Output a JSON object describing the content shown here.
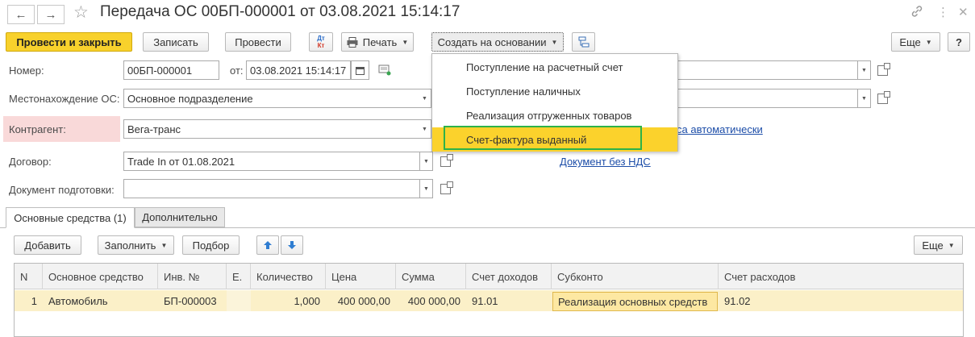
{
  "window": {
    "title": "Передача ОС 00БП-000001 от 03.08.2021 15:14:17"
  },
  "toolbar": {
    "post_close": "Провести и закрыть",
    "save": "Записать",
    "post": "Провести",
    "dtkt_top": "Дт",
    "dtkt_bottom": "Кт",
    "print": "Печать",
    "create_based": "Создать на основании",
    "more": "Еще",
    "help": "?"
  },
  "create_menu": {
    "items": [
      "Поступление на расчетный счет",
      "Поступление наличных",
      "Реализация отгруженных товаров",
      "Счет-фактура выданный"
    ],
    "highlighted_index": 3
  },
  "form": {
    "number_label": "Номер:",
    "number_value": "00БП-000001",
    "date_label": "от:",
    "date_value": "03.08.2021 15:14:17",
    "location_label": "Местонахождение ОС:",
    "location_value": "Основное подразделение",
    "counterparty_label": "Контрагент:",
    "counterparty_value": "Вега-транс",
    "contract_label": "Договор:",
    "contract_value": "Trade In от 01.08.2021",
    "prep_doc_label": "Документ подготовки:",
    "prep_doc_value": "",
    "link_auto": "са автоматически",
    "link_no_vat": "Документ без НДС"
  },
  "tabs": [
    {
      "label": "Основные средства (1)",
      "active": true
    },
    {
      "label": "Дополнительно",
      "active": false
    }
  ],
  "table_toolbar": {
    "add": "Добавить",
    "fill": "Заполнить",
    "select": "Подбор",
    "more": "Еще"
  },
  "table": {
    "columns": [
      "N",
      "Основное средство",
      "Инв. №",
      "Е.",
      "Количество",
      "Цена",
      "Сумма",
      "Счет доходов",
      "Субконто",
      "Счет расходов"
    ],
    "rows": [
      [
        "1",
        "Автомобиль",
        "БП-000003",
        "",
        "1,000",
        "400 000,00",
        "400 000,00",
        "91.01",
        "Реализация основных средств",
        "91.02"
      ]
    ]
  },
  "colors": {
    "primary_button": "#f8d12c",
    "highlight_menu": "#fbd22c",
    "focus_outline": "#2db24a",
    "required_row": "#f9d9d9",
    "selected_row": "#fbf0c8",
    "link": "#1c4da8"
  }
}
